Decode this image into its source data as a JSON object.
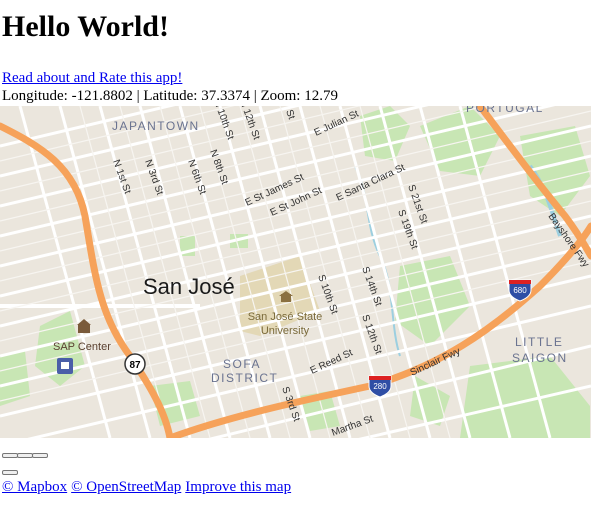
{
  "page": {
    "heading": "Hello World!",
    "rate_link": "Read about and Rate this app!",
    "coords_text": "Longitude: -121.8802 | Latitude: 37.3374 | Zoom: 12.79"
  },
  "map": {
    "colors": {
      "land": "#ebe6dd",
      "park": "#c8e6b4",
      "water": "#9ccfe0",
      "road": "#ffffff",
      "highway": "#f6a25a",
      "campus": "#e3d8b6"
    },
    "labels": {
      "city": "San José",
      "university_line1": "San José State",
      "university_line2": "University",
      "japantown": "JAPANTOWN",
      "sofa_line1": "SOFA",
      "sofa_line2": "DISTRICT",
      "little_saigon_line1": "LITTLE",
      "little_saigon_line2": "SAIGON",
      "portugal": "PORTUGAL",
      "sap_center": "SAP Center",
      "st_n1": "N 1st St",
      "st_n3": "N 3rd St",
      "st_n6": "N 6th St",
      "st_n8": "N 8th St",
      "st_n10": "N 10th St",
      "st_n12": "N 12th St",
      "st_julian": "E Julian St",
      "st_stjames": "E St James St",
      "st_stjohn": "E St John St",
      "st_santaclara": "E Santa Clara St",
      "st_21st": "S 21st St",
      "st_19th": "S 19th St",
      "st_10th": "S 10th St",
      "st_14th": "S 14th St",
      "st_12th": "S 12th St",
      "st_reed": "E Reed St",
      "st_3rd": "S 3rd St",
      "st_sinclair": "Sinclair Fwy",
      "st_martha": "Martha St",
      "st_bayshore": "Bayshore Fwy",
      "st_top_st": "St",
      "shield_87": "87",
      "shield_280": "280",
      "shield_680": "680"
    }
  },
  "controls": {
    "zoom_buttons": [
      "",
      "",
      ""
    ],
    "compass_button": ""
  },
  "attribution": {
    "mapbox": "© Mapbox",
    "osm": "© OpenStreetMap",
    "improve": "Improve this map"
  }
}
